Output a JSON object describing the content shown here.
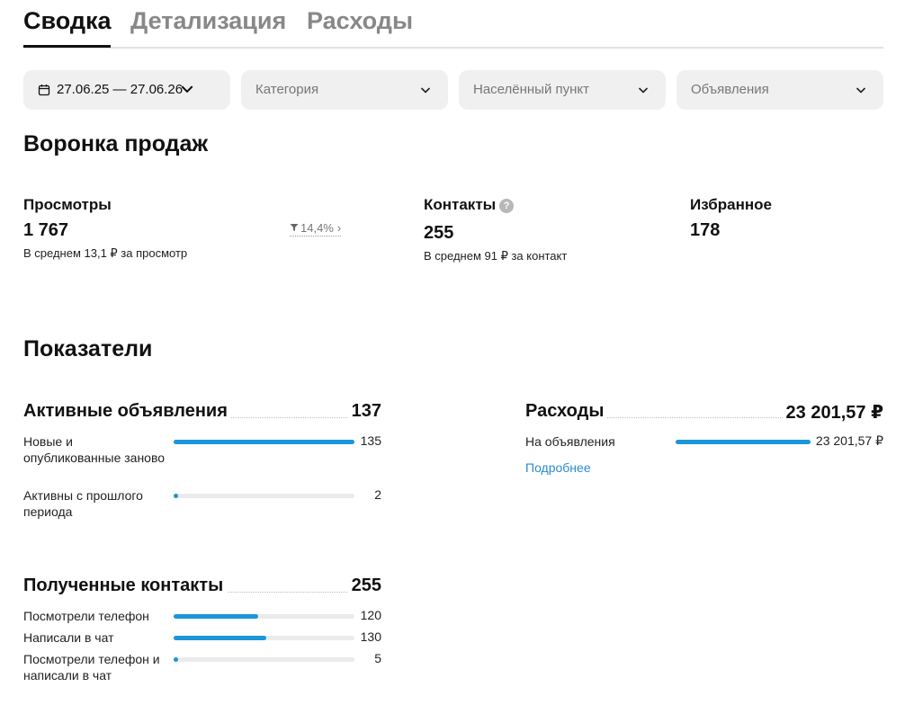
{
  "tabs": [
    {
      "label": "Сводка",
      "active": true
    },
    {
      "label": "Детализация",
      "active": false
    },
    {
      "label": "Расходы",
      "active": false
    }
  ],
  "filters": {
    "date": {
      "value": "27.06.25 — 27.06.26",
      "icon": "calendar-icon"
    },
    "category": {
      "placeholder": "Категория"
    },
    "city": {
      "placeholder": "Населённый пункт"
    },
    "ads": {
      "placeholder": "Объявления"
    }
  },
  "funnel": {
    "title": "Воронка продаж",
    "views": {
      "title": "Просмотры",
      "value": "1 767",
      "sub": "В среднем 13,1 ₽ за просмотр",
      "delta": "14,4%"
    },
    "contacts": {
      "title": "Контакты",
      "help": "?",
      "value": "255",
      "sub": "В среднем 91 ₽ за контакт"
    },
    "favorites": {
      "title": "Избранное",
      "value": "178"
    }
  },
  "indicators": {
    "title": "Показатели",
    "active_ads": {
      "title": "Активные объявления",
      "total": "137",
      "rows": [
        {
          "label": "Новые и опубликованные заново",
          "value": "135",
          "fill": 1.0
        },
        {
          "label": "Активны с прошлого периода",
          "value": "2",
          "fill": 0.015
        }
      ]
    },
    "contacts_received": {
      "title": "Полученные контакты",
      "total": "255",
      "rows": [
        {
          "label": "Посмотрели телефон",
          "value": "120",
          "fill": 0.47
        },
        {
          "label": "Написали в чат",
          "value": "130",
          "fill": 0.51
        },
        {
          "label": "Посмотрели телефон и написали в чат",
          "value": "5",
          "fill": 0.02
        }
      ]
    },
    "expenses": {
      "title": "Расходы",
      "total": "23 201,57 ₽",
      "rows": [
        {
          "label": "На объявления",
          "value": "23 201,57 ₽",
          "fill": 1.0
        }
      ],
      "link": "Подробнее"
    }
  },
  "colors": {
    "accent": "#1a96d9",
    "link": "#2a8bd0"
  }
}
